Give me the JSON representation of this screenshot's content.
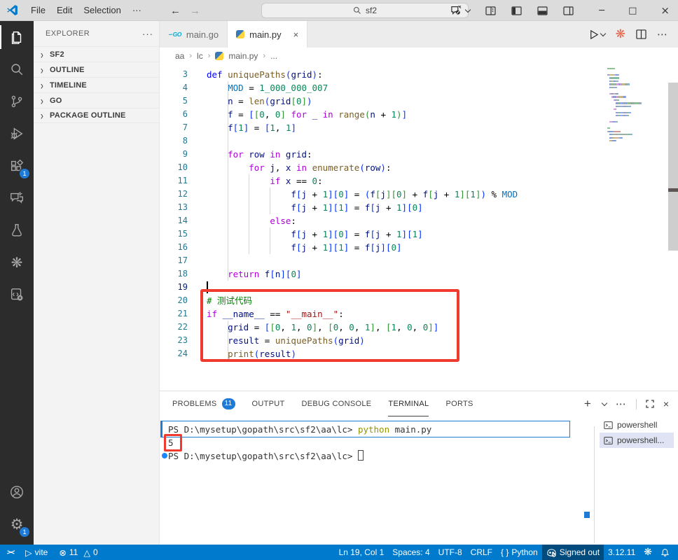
{
  "colors": {
    "accent": "#007acc",
    "annotation_red": "#ef3a2d",
    "badge_blue": "#1f7ad6",
    "command_decoration_blue": "#1a7fd4",
    "activity_bar_bg": "#2c2c2c",
    "sidebar_bg": "#f3f3f3",
    "titlebar_bg": "#dcdcdc"
  },
  "title_bar": {
    "menus": [
      "File",
      "Edit",
      "Selection",
      "···"
    ],
    "search_value": "sf2"
  },
  "activity_bar": {
    "extensions_badge": "1",
    "settings_badge": "1"
  },
  "sidebar": {
    "header": "EXPLORER",
    "more": "···",
    "sections": [
      {
        "label": "SF2"
      },
      {
        "label": "OUTLINE"
      },
      {
        "label": "TIMELINE"
      },
      {
        "label": "GO"
      },
      {
        "label": "PACKAGE OUTLINE"
      }
    ]
  },
  "editor": {
    "tabs": [
      {
        "label": "main.go"
      },
      {
        "label": "main.py",
        "close": "×"
      }
    ],
    "breadcrumb": {
      "a": "aa",
      "b": "lc",
      "c": "main.py",
      "d": "..."
    },
    "hidden_top_lines": [
      {
        "i": 0,
        "t": [
          [
            "m",
            "# ######## ####"
          ]
        ]
      },
      {
        "i": 0,
        "t": []
      }
    ],
    "lines": [
      {
        "n": 3,
        "i": 0,
        "t": [
          [
            "d",
            "def"
          ],
          [
            "o",
            " "
          ],
          [
            "f",
            "uniquePaths"
          ],
          [
            "b1",
            "("
          ],
          [
            "v",
            "grid"
          ],
          [
            "b1",
            ")"
          ],
          [
            "o",
            ":"
          ]
        ]
      },
      {
        "n": 4,
        "i": 4,
        "t": [
          [
            "c",
            "MOD"
          ],
          [
            "o",
            " = "
          ],
          [
            "n",
            "1_000_000_007"
          ]
        ]
      },
      {
        "n": 5,
        "i": 4,
        "t": [
          [
            "v",
            "n"
          ],
          [
            "o",
            " = "
          ],
          [
            "f",
            "len"
          ],
          [
            "b1",
            "("
          ],
          [
            "v",
            "grid"
          ],
          [
            "b2",
            "["
          ],
          [
            "n",
            "0"
          ],
          [
            "b2",
            "]"
          ],
          [
            "b1",
            ")"
          ]
        ]
      },
      {
        "n": 6,
        "i": 4,
        "t": [
          [
            "v",
            "f"
          ],
          [
            "o",
            " = "
          ],
          [
            "b1",
            "["
          ],
          [
            "b2",
            "["
          ],
          [
            "n",
            "0"
          ],
          [
            "o",
            ", "
          ],
          [
            "n",
            "0"
          ],
          [
            "b2",
            "]"
          ],
          [
            "o",
            " "
          ],
          [
            "k",
            "for"
          ],
          [
            "o",
            " "
          ],
          [
            "v",
            "_"
          ],
          [
            "o",
            " "
          ],
          [
            "k",
            "in"
          ],
          [
            "o",
            " "
          ],
          [
            "f",
            "range"
          ],
          [
            "b2",
            "("
          ],
          [
            "v",
            "n"
          ],
          [
            "o",
            " + "
          ],
          [
            "n",
            "1"
          ],
          [
            "b2",
            ")"
          ],
          [
            "b1",
            "]"
          ]
        ]
      },
      {
        "n": 7,
        "i": 4,
        "t": [
          [
            "v",
            "f"
          ],
          [
            "b1",
            "["
          ],
          [
            "n",
            "1"
          ],
          [
            "b1",
            "]"
          ],
          [
            "o",
            " = "
          ],
          [
            "b1",
            "["
          ],
          [
            "n",
            "1"
          ],
          [
            "o",
            ", "
          ],
          [
            "n",
            "1"
          ],
          [
            "b1",
            "]"
          ]
        ]
      },
      {
        "n": 8,
        "i": 8,
        "t": []
      },
      {
        "n": 9,
        "i": 4,
        "t": [
          [
            "k",
            "for"
          ],
          [
            "o",
            " "
          ],
          [
            "v",
            "row"
          ],
          [
            "o",
            " "
          ],
          [
            "k",
            "in"
          ],
          [
            "o",
            " "
          ],
          [
            "v",
            "grid"
          ],
          [
            "o",
            ":"
          ]
        ]
      },
      {
        "n": 10,
        "i": 8,
        "t": [
          [
            "k",
            "for"
          ],
          [
            "o",
            " "
          ],
          [
            "v",
            "j"
          ],
          [
            "o",
            ", "
          ],
          [
            "v",
            "x"
          ],
          [
            "o",
            " "
          ],
          [
            "k",
            "in"
          ],
          [
            "o",
            " "
          ],
          [
            "f",
            "enumerate"
          ],
          [
            "b1",
            "("
          ],
          [
            "v",
            "row"
          ],
          [
            "b1",
            ")"
          ],
          [
            "o",
            ":"
          ]
        ]
      },
      {
        "n": 11,
        "i": 12,
        "t": [
          [
            "k",
            "if"
          ],
          [
            "o",
            " "
          ],
          [
            "v",
            "x"
          ],
          [
            "o",
            " == "
          ],
          [
            "n",
            "0"
          ],
          [
            "o",
            ":"
          ]
        ]
      },
      {
        "n": 12,
        "i": 16,
        "t": [
          [
            "v",
            "f"
          ],
          [
            "b1",
            "["
          ],
          [
            "v",
            "j"
          ],
          [
            "o",
            " + "
          ],
          [
            "n",
            "1"
          ],
          [
            "b1",
            "]"
          ],
          [
            "b1",
            "["
          ],
          [
            "n",
            "0"
          ],
          [
            "b1",
            "]"
          ],
          [
            "o",
            " = "
          ],
          [
            "b1",
            "("
          ],
          [
            "v",
            "f"
          ],
          [
            "b2",
            "["
          ],
          [
            "v",
            "j"
          ],
          [
            "b2",
            "]"
          ],
          [
            "b2",
            "["
          ],
          [
            "n",
            "0"
          ],
          [
            "b2",
            "]"
          ],
          [
            "o",
            " + "
          ],
          [
            "v",
            "f"
          ],
          [
            "b2",
            "["
          ],
          [
            "v",
            "j"
          ],
          [
            "o",
            " + "
          ],
          [
            "n",
            "1"
          ],
          [
            "b2",
            "]"
          ],
          [
            "b2",
            "["
          ],
          [
            "n",
            "1"
          ],
          [
            "b2",
            "]"
          ],
          [
            "b1",
            ")"
          ],
          [
            "o",
            " % "
          ],
          [
            "c",
            "MOD"
          ]
        ]
      },
      {
        "n": 13,
        "i": 16,
        "t": [
          [
            "v",
            "f"
          ],
          [
            "b1",
            "["
          ],
          [
            "v",
            "j"
          ],
          [
            "o",
            " + "
          ],
          [
            "n",
            "1"
          ],
          [
            "b1",
            "]"
          ],
          [
            "b1",
            "["
          ],
          [
            "n",
            "1"
          ],
          [
            "b1",
            "]"
          ],
          [
            "o",
            " = "
          ],
          [
            "v",
            "f"
          ],
          [
            "b1",
            "["
          ],
          [
            "v",
            "j"
          ],
          [
            "o",
            " + "
          ],
          [
            "n",
            "1"
          ],
          [
            "b1",
            "]"
          ],
          [
            "b1",
            "["
          ],
          [
            "n",
            "0"
          ],
          [
            "b1",
            "]"
          ]
        ]
      },
      {
        "n": 14,
        "i": 12,
        "t": [
          [
            "k",
            "else"
          ],
          [
            "o",
            ":"
          ]
        ]
      },
      {
        "n": 15,
        "i": 16,
        "t": [
          [
            "v",
            "f"
          ],
          [
            "b1",
            "["
          ],
          [
            "v",
            "j"
          ],
          [
            "o",
            " + "
          ],
          [
            "n",
            "1"
          ],
          [
            "b1",
            "]"
          ],
          [
            "b1",
            "["
          ],
          [
            "n",
            "0"
          ],
          [
            "b1",
            "]"
          ],
          [
            "o",
            " = "
          ],
          [
            "v",
            "f"
          ],
          [
            "b1",
            "["
          ],
          [
            "v",
            "j"
          ],
          [
            "o",
            " + "
          ],
          [
            "n",
            "1"
          ],
          [
            "b1",
            "]"
          ],
          [
            "b1",
            "["
          ],
          [
            "n",
            "1"
          ],
          [
            "b1",
            "]"
          ]
        ]
      },
      {
        "n": 16,
        "i": 16,
        "t": [
          [
            "v",
            "f"
          ],
          [
            "b1",
            "["
          ],
          [
            "v",
            "j"
          ],
          [
            "o",
            " + "
          ],
          [
            "n",
            "1"
          ],
          [
            "b1",
            "]"
          ],
          [
            "b1",
            "["
          ],
          [
            "n",
            "1"
          ],
          [
            "b1",
            "]"
          ],
          [
            "o",
            " = "
          ],
          [
            "v",
            "f"
          ],
          [
            "b1",
            "["
          ],
          [
            "v",
            "j"
          ],
          [
            "b1",
            "]"
          ],
          [
            "b1",
            "["
          ],
          [
            "n",
            "0"
          ],
          [
            "b1",
            "]"
          ]
        ]
      },
      {
        "n": 17,
        "i": 8,
        "t": []
      },
      {
        "n": 18,
        "i": 4,
        "t": [
          [
            "k",
            "return"
          ],
          [
            "o",
            " "
          ],
          [
            "v",
            "f"
          ],
          [
            "b1",
            "["
          ],
          [
            "v",
            "n"
          ],
          [
            "b1",
            "]"
          ],
          [
            "b1",
            "["
          ],
          [
            "n",
            "0"
          ],
          [
            "b1",
            "]"
          ]
        ]
      },
      {
        "n": 19,
        "i": 0,
        "cur": true,
        "t": []
      },
      {
        "n": 20,
        "i": 0,
        "t": [
          [
            "m",
            "# 测试代码"
          ]
        ]
      },
      {
        "n": 21,
        "i": 0,
        "t": [
          [
            "k",
            "if"
          ],
          [
            "o",
            " "
          ],
          [
            "v",
            "__name__"
          ],
          [
            "o",
            " == "
          ],
          [
            "s",
            "\"__main__\""
          ],
          [
            "o",
            ":"
          ]
        ]
      },
      {
        "n": 22,
        "i": 4,
        "t": [
          [
            "v",
            "grid"
          ],
          [
            "o",
            " = "
          ],
          [
            "b1",
            "["
          ],
          [
            "b2",
            "["
          ],
          [
            "n",
            "0"
          ],
          [
            "o",
            ", "
          ],
          [
            "n",
            "1"
          ],
          [
            "o",
            ", "
          ],
          [
            "n",
            "0"
          ],
          [
            "b2",
            "]"
          ],
          [
            "o",
            ", "
          ],
          [
            "b2",
            "["
          ],
          [
            "n",
            "0"
          ],
          [
            "o",
            ", "
          ],
          [
            "n",
            "0"
          ],
          [
            "o",
            ", "
          ],
          [
            "n",
            "1"
          ],
          [
            "b2",
            "]"
          ],
          [
            "o",
            ", "
          ],
          [
            "b2",
            "["
          ],
          [
            "n",
            "1"
          ],
          [
            "o",
            ", "
          ],
          [
            "n",
            "0"
          ],
          [
            "o",
            ", "
          ],
          [
            "n",
            "0"
          ],
          [
            "b2",
            "]"
          ],
          [
            "b1",
            "]"
          ]
        ]
      },
      {
        "n": 23,
        "i": 4,
        "t": [
          [
            "v",
            "result"
          ],
          [
            "o",
            " = "
          ],
          [
            "f",
            "uniquePaths"
          ],
          [
            "b1",
            "("
          ],
          [
            "v",
            "grid"
          ],
          [
            "b1",
            ")"
          ]
        ]
      },
      {
        "n": 24,
        "i": 4,
        "t": [
          [
            "f",
            "print"
          ],
          [
            "b1",
            "("
          ],
          [
            "v",
            "result"
          ],
          [
            "b1",
            ")"
          ]
        ]
      }
    ]
  },
  "panel": {
    "tabs": [
      {
        "label": "PROBLEMS",
        "badge": "11"
      },
      {
        "label": "OUTPUT"
      },
      {
        "label": "DEBUG CONSOLE"
      },
      {
        "label": "TERMINAL",
        "active": true
      },
      {
        "label": "PORTS"
      }
    ],
    "terminal": {
      "lines": [
        {
          "parts": [
            [
              "p",
              "PS D:\\mysetup\\gopath\\src\\sf2\\aa\\lc> "
            ],
            [
              "y",
              "python"
            ],
            [
              "p",
              " main.py"
            ]
          ]
        },
        {
          "parts": [
            [
              "p",
              "5"
            ]
          ]
        },
        {
          "parts": [
            [
              "p",
              "PS D:\\mysetup\\gopath\\src\\sf2\\aa\\lc> "
            ]
          ],
          "cursor": true
        }
      ],
      "list": [
        {
          "label": "powershell"
        },
        {
          "label": "powershell...",
          "selected": true
        }
      ]
    }
  },
  "status_bar": {
    "vite": "vite",
    "errors": "11",
    "warnings": "0",
    "line_col": "Ln 19, Col 1",
    "spaces": "Spaces: 4",
    "encoding": "UTF-8",
    "eol": "CRLF",
    "braces": "{ }",
    "language": "Python",
    "copilot": "Signed out",
    "python_version": "3.12.11"
  }
}
